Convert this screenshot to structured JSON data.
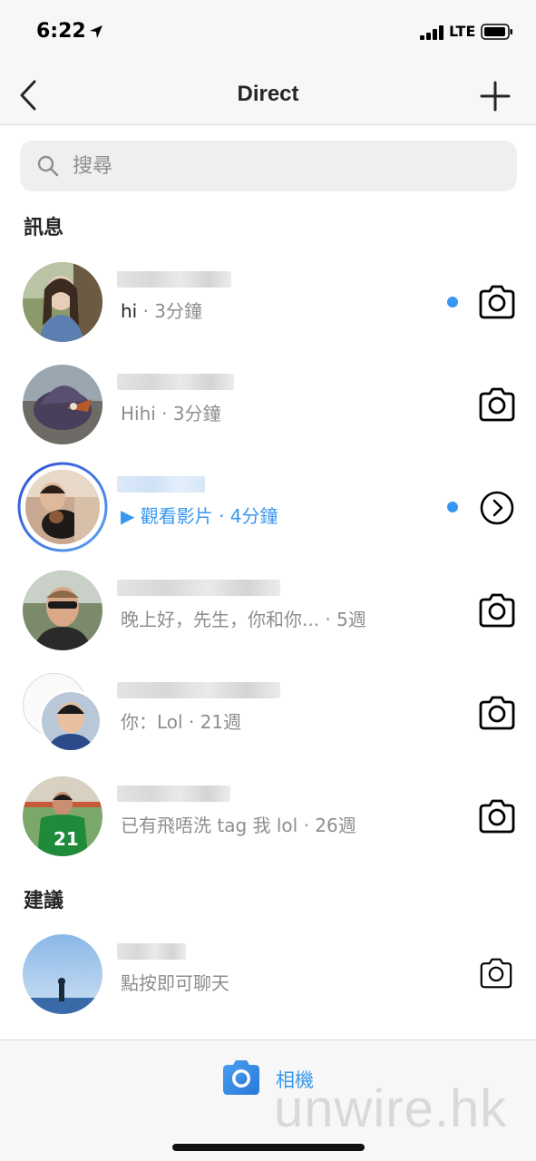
{
  "status_bar": {
    "time": "6:22",
    "network": "LTE"
  },
  "nav": {
    "title": "Direct"
  },
  "search": {
    "placeholder": "搜尋"
  },
  "sections": {
    "messages": "訊息",
    "suggestions": "建議"
  },
  "threads": [
    {
      "preview_strong": "hi",
      "preview": " · 3分鐘",
      "unread": true,
      "action": "camera-icon"
    },
    {
      "preview_strong": "",
      "preview": "Hihi · 3分鐘",
      "unread": false,
      "action": "camera-icon"
    },
    {
      "preview_strong": "",
      "preview": "▶ 觀看影片 · 4分鐘",
      "unread": true,
      "action": "chevron-right-circle-icon"
    },
    {
      "preview_strong": "",
      "preview": "晚上好，先生，你和你...   · 5週",
      "unread": false,
      "action": "camera-icon"
    },
    {
      "preview_strong": "",
      "preview": "你：Lol · 21週",
      "unread": false,
      "action": "camera-icon"
    },
    {
      "preview_strong": "",
      "preview": "已有飛唔洗 tag 我 lol · 26週",
      "unread": false,
      "action": "camera-icon"
    }
  ],
  "suggestion": {
    "preview": "點按即可聊天",
    "action": "camera-icon"
  },
  "bottom": {
    "camera_label": "相機",
    "watermark": "unwire.hk"
  },
  "colors": {
    "accent": "#3897f0",
    "text": "#262626",
    "secondary": "#8e8e8e",
    "bar": "#f7f7f7"
  }
}
